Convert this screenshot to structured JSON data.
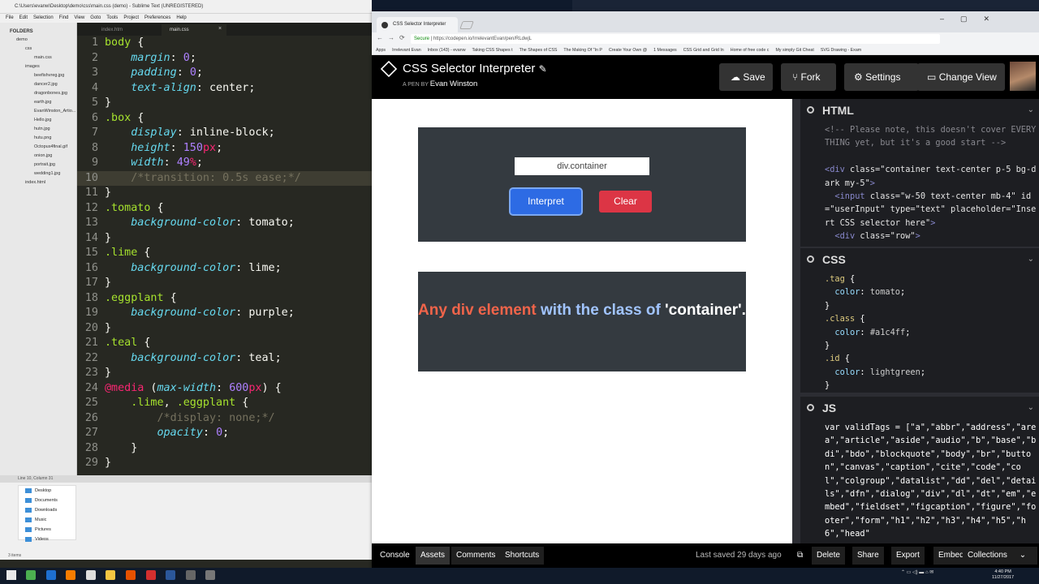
{
  "sublime": {
    "title": "C:\\Users\\evanw\\Desktop\\demo\\css\\main.css (demo) - Sublime Text (UNREGISTERED)",
    "menu": [
      "File",
      "Edit",
      "Selection",
      "Find",
      "View",
      "Goto",
      "Tools",
      "Project",
      "Preferences",
      "Help"
    ],
    "folders_label": "FOLDERS",
    "tree": [
      {
        "name": "demo",
        "level": "top"
      },
      {
        "name": "css",
        "level": "sub"
      },
      {
        "name": "main.css",
        "level": "file"
      },
      {
        "name": "images",
        "level": "sub"
      },
      {
        "name": "beefishvreg.jpg",
        "level": "file"
      },
      {
        "name": "dancer2.jpg",
        "level": "file"
      },
      {
        "name": "dragonbones.jpg",
        "level": "file"
      },
      {
        "name": "earth.jpg",
        "level": "file"
      },
      {
        "name": "EvanWinston_Artio...",
        "level": "file"
      },
      {
        "name": "Hello.jpg",
        "level": "file"
      },
      {
        "name": "hutn.jpg",
        "level": "file"
      },
      {
        "name": "hutu.png",
        "level": "file"
      },
      {
        "name": "Octopus4final.gif",
        "level": "file"
      },
      {
        "name": "onion.jpg",
        "level": "file"
      },
      {
        "name": "portrait.jpg",
        "level": "file"
      },
      {
        "name": "wedding1.jpg",
        "level": "file"
      },
      {
        "name": "index.html",
        "level": "sub"
      }
    ],
    "tabs": [
      "index.htm",
      "main.css"
    ],
    "status": "Line 10, Column 31",
    "explorer": [
      "Desktop",
      "Documents",
      "Downloads",
      "Music",
      "Pictures",
      "Videos"
    ],
    "explorer_count": "3 items",
    "code_lines": [
      {
        "n": "1",
        "h": "<span class='sel'>body</span> {"
      },
      {
        "n": "2",
        "h": "    <span class='prop'>margin</span>: <span class='num'>0</span>;"
      },
      {
        "n": "3",
        "h": "    <span class='prop'>padding</span>: <span class='num'>0</span>;"
      },
      {
        "n": "4",
        "h": "    <span class='prop'>text-align</span>: <span class='txt'>center</span>;"
      },
      {
        "n": "5",
        "h": "}"
      },
      {
        "n": "6",
        "h": "<span class='sel'>.box</span> {"
      },
      {
        "n": "7",
        "h": "    <span class='prop'>display</span>: <span class='txt'>inline-block</span>;"
      },
      {
        "n": "8",
        "h": "    <span class='prop'>height</span>: <span class='num'>150</span><span class='unit'>px</span>;"
      },
      {
        "n": "9",
        "h": "    <span class='prop'>width</span>: <span class='num'>49</span><span class='unit'>%</span>;"
      },
      {
        "n": "10",
        "h": "    <span class='cmt'>/*transition: 0.5s ease;*/</span>",
        "cur": true
      },
      {
        "n": "11",
        "h": "}"
      },
      {
        "n": "12",
        "h": "<span class='sel'>.tomato</span> {"
      },
      {
        "n": "13",
        "h": "    <span class='prop'>background-color</span>: <span class='txt'>tomato</span>;"
      },
      {
        "n": "14",
        "h": "}"
      },
      {
        "n": "15",
        "h": "<span class='sel'>.lime</span> {"
      },
      {
        "n": "16",
        "h": "    <span class='prop'>background-color</span>: <span class='txt'>lime</span>;"
      },
      {
        "n": "17",
        "h": "}"
      },
      {
        "n": "18",
        "h": "<span class='sel'>.eggplant</span> {"
      },
      {
        "n": "19",
        "h": "    <span class='prop'>background-color</span>: <span class='txt'>purple</span>;"
      },
      {
        "n": "20",
        "h": "}"
      },
      {
        "n": "21",
        "h": "<span class='sel'>.teal</span> {"
      },
      {
        "n": "22",
        "h": "    <span class='prop'>background-color</span>: <span class='txt'>teal</span>;"
      },
      {
        "n": "23",
        "h": "}"
      },
      {
        "n": "24",
        "h": "<span class='kw'>@media</span> (<span class='prop'>max-width</span>: <span class='num'>600</span><span class='unit'>px</span>) {"
      },
      {
        "n": "25",
        "h": "    <span class='sel'>.lime</span>, <span class='sel'>.eggplant</span> {"
      },
      {
        "n": "26",
        "h": "        <span class='cmt'>/*display: none;*/</span>"
      },
      {
        "n": "27",
        "h": "        <span class='prop'>opacity</span>: <span class='num'>0</span>;"
      },
      {
        "n": "28",
        "h": "    }"
      },
      {
        "n": "29",
        "h": "}"
      }
    ]
  },
  "browser": {
    "tab_title": "CSS Selector Interpreter",
    "secure_label": "Secure",
    "url": "https://codepen.io/IrrelevantEvan/pen/RLdwjL",
    "bookmarks": [
      "Apps",
      "Irrelevant Evan",
      "Inbox (143) - evanw",
      "Taking CSS Shapes t",
      "The Shapes of CSS",
      "The Making Of \"In P",
      "Create Your Own @",
      "1 Messages",
      "CSS Grid and Grid In",
      "Home of free code c",
      "My simply Git Cheat",
      "SVG Drawing - Exam"
    ]
  },
  "codepen": {
    "title": "CSS Selector Interpreter",
    "by_prefix": "A PEN BY",
    "author": "Evan Winston",
    "buttons": {
      "save": "Save",
      "fork": "Fork",
      "settings": "Settings",
      "change_view": "Change View"
    },
    "preview": {
      "input_value": "div.container",
      "interpret": "Interpret",
      "clear": "Clear",
      "result_parts": [
        {
          "text": "Any div element",
          "color": "#f0644a"
        },
        {
          "text": " with the class of ",
          "color": "#a1c4ff"
        },
        {
          "text": "'container'.",
          "color": "#ffffff"
        }
      ]
    },
    "html_panel": {
      "label": "HTML",
      "lines": [
        {
          "h": "<span class='h-cmt'>&lt;!-- Please note, this doesn't cover EVERYTHING yet, but it's a good start --&gt;</span>"
        },
        {
          "h": " "
        },
        {
          "h": "<span class='h-tag'>&lt;div</span> <span class='h-attr'>class=</span><span class='h-val'>\"container text-center p-5 bg-dark my-5\"</span><span class='h-tag'>&gt;</span>"
        },
        {
          "h": "  <span class='h-tag'>&lt;input</span> <span class='h-attr'>class=</span><span class='h-val'>\"w-50 text-center mb-4\" id=\"userInput\" type=\"text\" placeholder=\"Insert CSS selector here\"</span><span class='h-tag'>&gt;</span>"
        },
        {
          "h": "  <span class='h-tag'>&lt;div</span> <span class='h-attr'>class=</span><span class='h-val'>\"row\"</span><span class='h-tag'>&gt;</span>"
        }
      ]
    },
    "css_panel": {
      "label": "CSS",
      "lines": [
        {
          "h": "<span class='c-sel'>.tag</span> {"
        },
        {
          "h": "  <span class='c-prop'>color</span>: <span class='c-val'>tomato</span>;"
        },
        {
          "h": "}"
        },
        {
          "h": "<span class='c-sel'>.class</span> {"
        },
        {
          "h": "  <span class='c-prop'>color</span>: <span class='c-val'>#a1c4ff</span>;"
        },
        {
          "h": "}"
        },
        {
          "h": "<span class='c-sel'>.id</span> {"
        },
        {
          "h": "  <span class='c-prop'>color</span>: <span class='c-val'>lightgreen</span>;"
        },
        {
          "h": "}"
        }
      ]
    },
    "js_panel": {
      "label": "JS",
      "lines": [
        {
          "h": "var validTags = [\"a\",\"abbr\",\"address\",\"area\",\"article\",\"aside\",\"audio\",\"b\",\"base\",\"bdi\",\"bdo\",\"blockquote\",\"body\",\"br\",\"button\",\"canvas\",\"caption\",\"cite\",\"code\",\"col\",\"colgroup\",\"datalist\",\"dd\",\"del\",\"details\",\"dfn\",\"dialog\",\"div\",\"dl\",\"dt\",\"em\",\"embed\",\"fieldset\",\"figcaption\",\"figure\",\"footer\",\"form\",\"h1\",\"h2\",\"h3\",\"h4\",\"h5\",\"h6\",\"head\""
        }
      ]
    },
    "footer": {
      "console": "Console",
      "assets": "Assets",
      "comments": "Comments",
      "shortcuts": "Shortcuts",
      "last_saved": "Last saved 29 days ago",
      "delete": "Delete",
      "share": "Share",
      "export": "Export",
      "embed": "Embed",
      "collections": "Collections"
    }
  },
  "taskbar": {
    "time": "4:40 PM",
    "date": "11/27/2017",
    "icon_colors": [
      "#4caf50",
      "#1e6fd0",
      "#f57c00",
      "#ddd",
      "#f4c542",
      "#e65100",
      "#d32f2f",
      "#2b579a",
      "#666",
      "#777"
    ]
  }
}
